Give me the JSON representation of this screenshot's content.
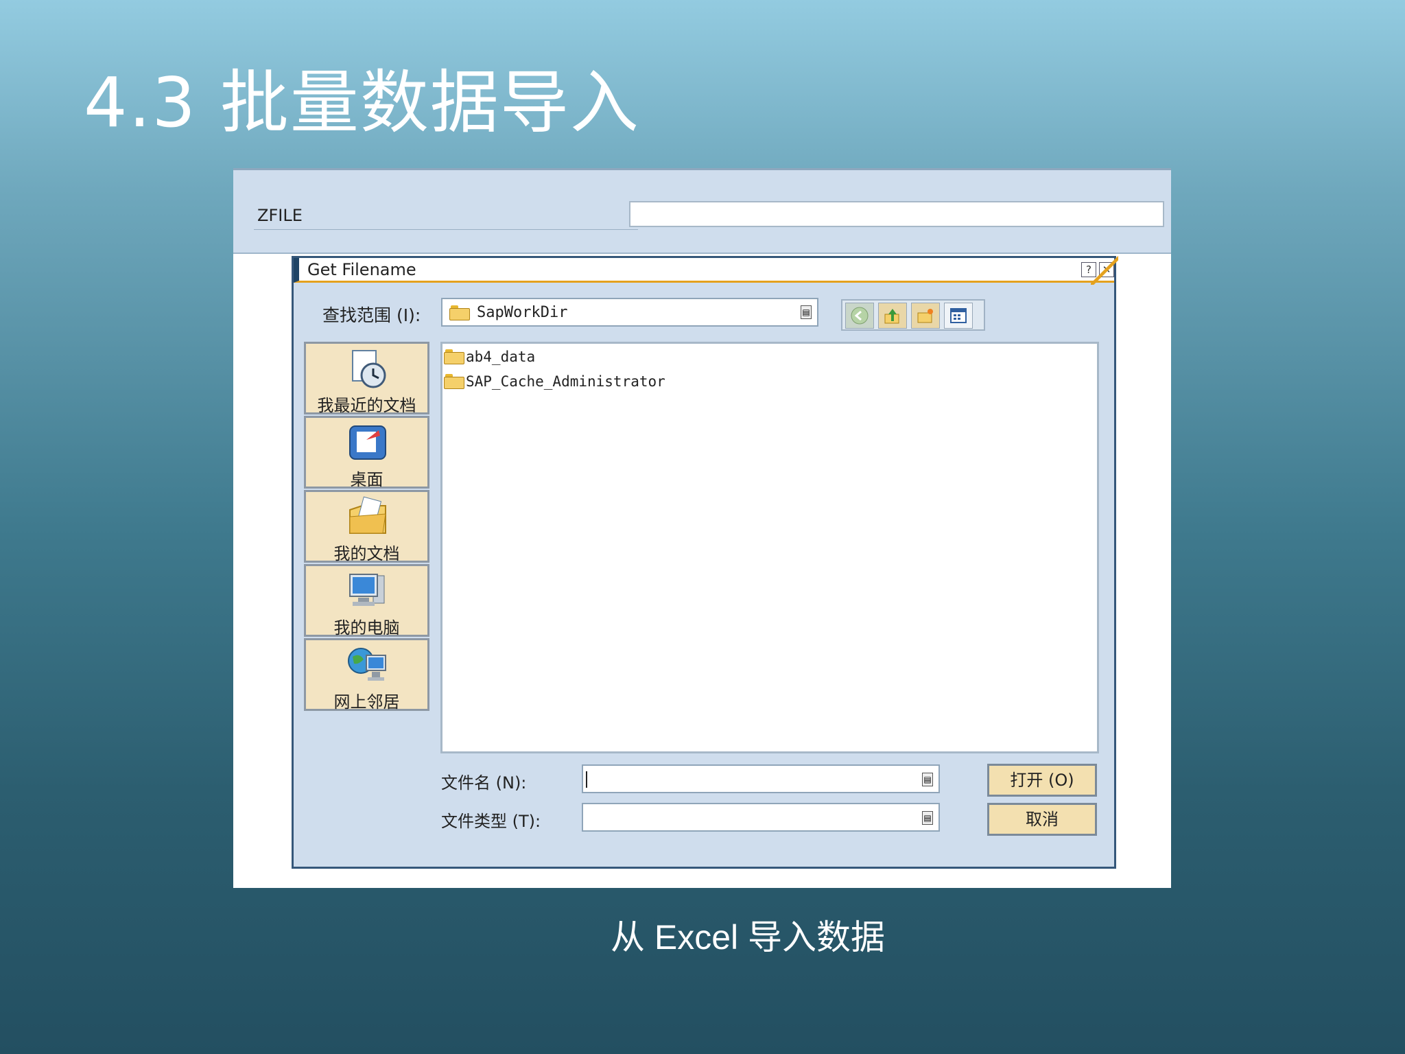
{
  "slide": {
    "title": "4.3  批量数据导入",
    "caption": "从 Excel 导入数据"
  },
  "selection_screen": {
    "zfile_label": "ZFILE",
    "zfile_value": ""
  },
  "dialog": {
    "title": "Get Filename",
    "help_button": "?",
    "close_button": "✕",
    "look_in_label": "查找范围 (I):",
    "look_in_value": "SapWorkDir",
    "toolbar": [
      "back-icon",
      "up-folder-icon",
      "new-folder-icon",
      "view-menu-icon"
    ],
    "places": [
      {
        "label": "我最近的文档",
        "icon": "recent-documents-icon"
      },
      {
        "label": "桌面",
        "icon": "desktop-icon"
      },
      {
        "label": "我的文档",
        "icon": "my-documents-icon"
      },
      {
        "label": "我的电脑",
        "icon": "my-computer-icon"
      },
      {
        "label": "网上邻居",
        "icon": "network-places-icon"
      }
    ],
    "files": [
      {
        "name": "ab4_data",
        "icon": "folder-icon"
      },
      {
        "name": "SAP_Cache_Administrator",
        "icon": "folder-icon"
      }
    ],
    "filename_label": "文件名 (N):",
    "filename_value": "",
    "filetype_label": "文件类型 (T):",
    "filetype_value": "",
    "open_button": "打开 (O)",
    "cancel_button": "取消"
  },
  "colors": {
    "dialog_bg": "#cfdded",
    "title_accent": "#e4a11e",
    "button_bg": "#f3e0b0"
  }
}
